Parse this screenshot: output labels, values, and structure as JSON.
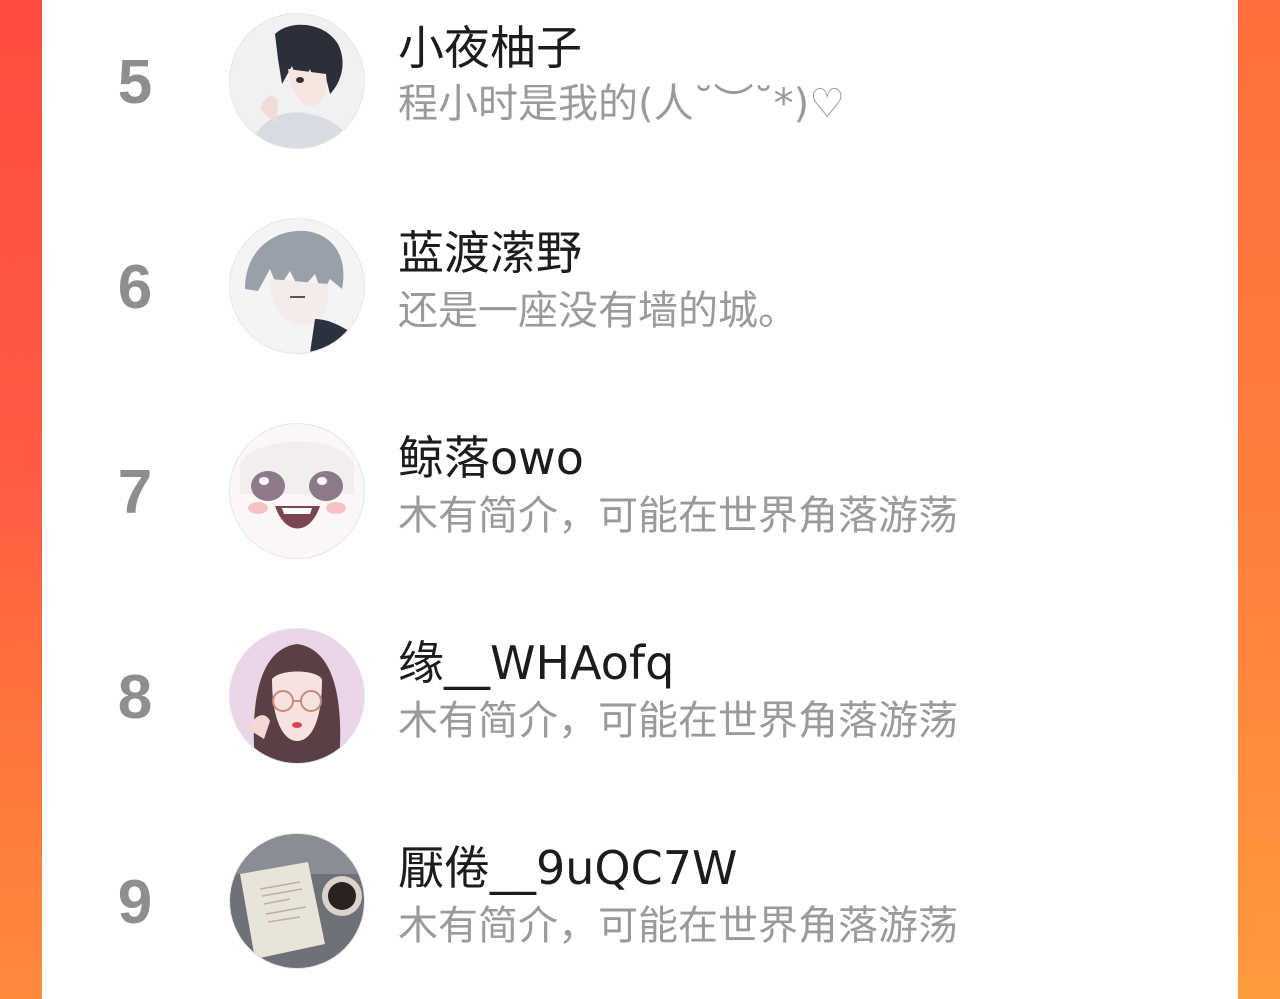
{
  "accent_colors": {
    "background_left": "#ff4b3e",
    "background_right": "#ff8a3c",
    "rank_text": "#8e8e8e",
    "name_text": "#1c1c1c",
    "bio_text": "#9a9a9a"
  },
  "ranking": {
    "items": [
      {
        "rank": "5",
        "name": "小夜柚子",
        "bio": "程小时是我的(人˘︶˘*)♡",
        "avatar": "avatar-anime-boy-dark-hair"
      },
      {
        "rank": "6",
        "name": "蓝渡潆野",
        "bio": "还是一座没有墙的城。",
        "avatar": "avatar-anime-boy-silver-hair"
      },
      {
        "rank": "7",
        "name": "鲸落owo",
        "bio": "木有简介，可能在世界角落游荡",
        "avatar": "avatar-anime-girl-crying"
      },
      {
        "rank": "8",
        "name": "缘__WHAofq",
        "bio": "木有简介，可能在世界角落游荡",
        "avatar": "avatar-girl-glasses"
      },
      {
        "rank": "9",
        "name": "厭倦__9uQC7W",
        "bio": "木有简介，可能在世界角落游荡",
        "avatar": "avatar-book-and-coffee"
      }
    ]
  }
}
